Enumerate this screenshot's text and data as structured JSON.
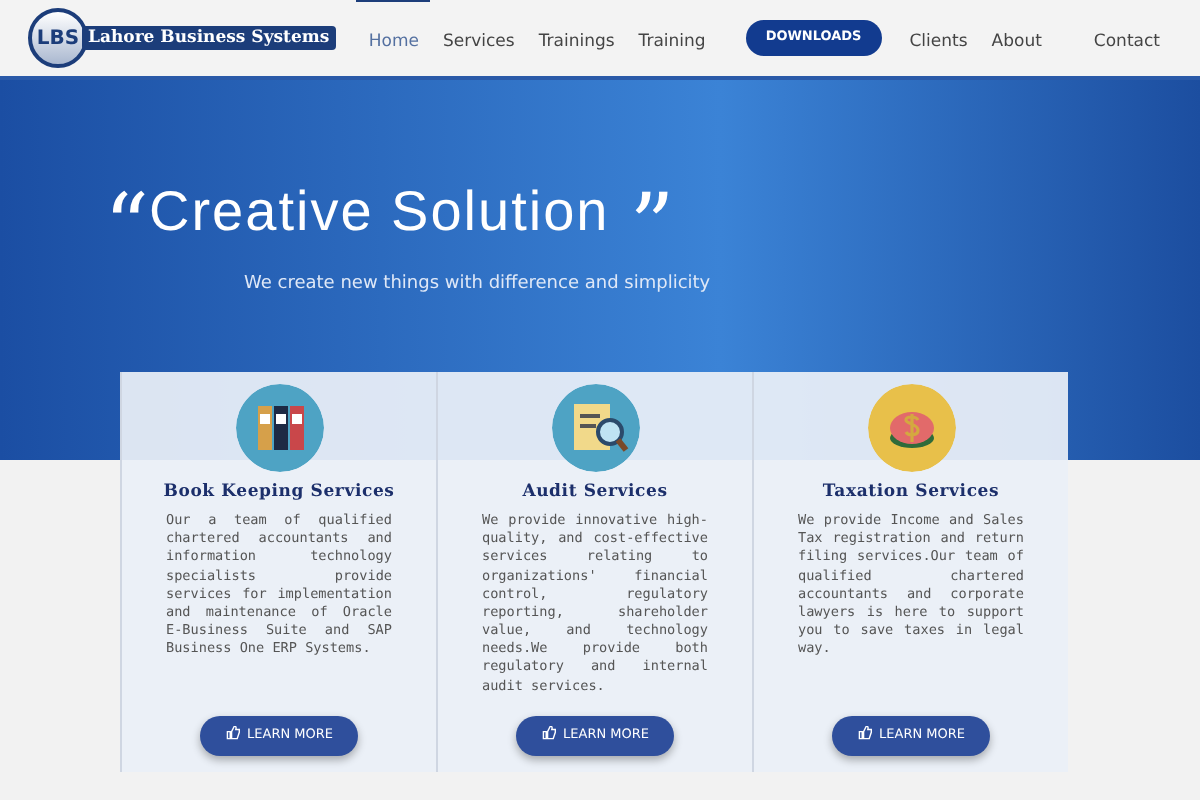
{
  "navbar": {
    "logo_mark": "LBS",
    "logo_text": "Lahore Business Systems",
    "links": [
      {
        "label": "Home",
        "selected": true,
        "kind": "link"
      },
      {
        "label": "Services",
        "selected": false,
        "kind": "link"
      },
      {
        "label": "Trainings",
        "selected": false,
        "kind": "link"
      },
      {
        "label": "Training",
        "selected": false,
        "kind": "link"
      },
      {
        "label": "DOWNLOADS",
        "selected": false,
        "kind": "button"
      },
      {
        "label": "Clients",
        "selected": false,
        "kind": "link"
      },
      {
        "label": "About",
        "selected": false,
        "kind": "link"
      },
      {
        "label": "Contact",
        "selected": false,
        "kind": "link"
      }
    ]
  },
  "hero": {
    "open_quote": "“",
    "title": "Creative Solution",
    "close_quote": "”",
    "tagline": "We create new things with difference and simplicity"
  },
  "services": [
    {
      "title": "Book Keeping Services",
      "text": "Our a team of qualified chartered accountants and information technology specialists provide services for implementation and maintenance of Oracle E-Business Suite and SAP Business One ERP Systems.",
      "button": "LEARN MORE"
    },
    {
      "title": "Audit Services",
      "text": "We provide innovative high-quality, and cost-effective services relating to organizations' financial control, regulatory reporting, shareholder value, and technology needs.We provide both regulatory and internal audit services.",
      "button": "LEARN MORE"
    },
    {
      "title": "Taxation Services",
      "text": "We provide Income and Sales Tax registration and return filing services.Our team of qualified chartered accountants and corporate lawyers is here to support you to save taxes in legal way.",
      "button": "LEARN MORE"
    }
  ]
}
